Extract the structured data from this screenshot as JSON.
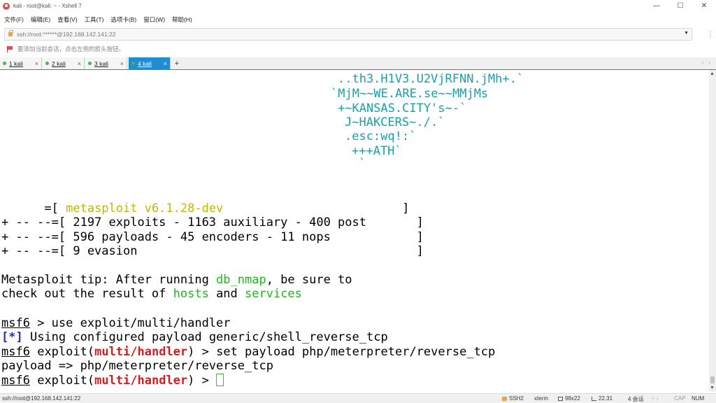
{
  "window": {
    "title": "kali - root@kali: ~ - Xshell 7",
    "controls": {
      "minimize": "—",
      "maximize": "☐",
      "close": "✕"
    }
  },
  "menu": [
    "文件(F)",
    "编辑(E)",
    "查看(V)",
    "工具(T)",
    "选项卡(B)",
    "窗口(W)",
    "帮助(H)"
  ],
  "address": {
    "value": "ssh://root:******@192.168.142.141:22",
    "dropdown": "▼"
  },
  "hint": {
    "text": "要添加当前会话，点击左侧的箭头按钮。"
  },
  "tabs": [
    {
      "label": "1 kali",
      "active": false
    },
    {
      "label": "2 kali",
      "active": false
    },
    {
      "label": "3 kali",
      "active": false
    },
    {
      "label": "4 kali",
      "active": true
    }
  ],
  "tab_close": "×",
  "tab_add": "+",
  "tab_nav": "‹ ›",
  "terminal": {
    "banner": [
      "..th3.H1V3.U2VjRFNN.jMh+.`",
      "`MjM~~WE.ARE.se~~MMjMs",
      "+~KANSAS.CITY's~-`",
      "J~HAKCERS~./.`",
      ".esc:wq!:`",
      "+++ATH`",
      "`"
    ],
    "info": {
      "line1_prefix": "      =[ ",
      "version": "metasploit v6.1.28-dev",
      "line1_suffix": "                         ]",
      "line2": "+ -- --=[ 2197 exploits - 1163 auxiliary - 400 post       ]",
      "line3": "+ -- --=[ 596 payloads - 45 encoders - 11 nops            ]",
      "line4": "+ -- --=[ 9 evasion                                       ]"
    },
    "tip": {
      "part1": "Metasploit tip: After running ",
      "cmd": "db_nmap",
      "part2": ", be sure to",
      "part3": "check out the result of ",
      "hosts": "hosts",
      "and": " and ",
      "services": "services"
    },
    "prompt": "msf6",
    "exploit_word": "exploit(",
    "module": "multi/handler",
    "exploit_close": ")",
    "cmd1": " > use exploit/multi/handler",
    "info_marker": "[*]",
    "info_text": " Using configured payload generic/shell_reverse_tcp",
    "cmd2": " > set payload php/meterpreter/reverse_tcp",
    "payload_result": "payload => php/meterpreter/reverse_tcp",
    "prompt_end": " > "
  },
  "statusbar": {
    "connection": "ssh://root@192.168.142.141:22",
    "protocol": "SSH2",
    "term": "xterm",
    "size": "98x22",
    "position": "22,31",
    "sessions": "4 会话",
    "caps": "CAP",
    "num": "NUM"
  },
  "colors": {
    "banner": "#1aa0a8",
    "version": "#c2b800",
    "highlight": "#22b521",
    "module": "#d11f1f",
    "info_marker": "#1f2fc2",
    "tab_active": "#1f8cd3"
  }
}
